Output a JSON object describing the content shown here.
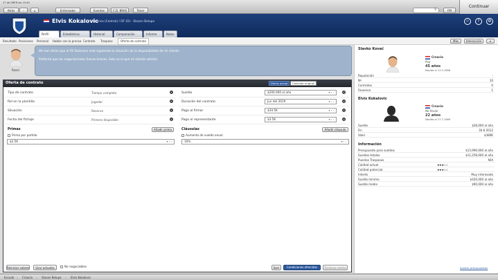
{
  "topbar": {
    "datetime": "17 de ENER las 15:45",
    "back": "Atrás",
    "fwd": "›",
    "nav": [
      "Entrenador",
      "Eventos",
      "C.D. BRAS",
      "Tener"
    ],
    "search_placeholder": "",
    "fm_badge": "FM",
    "continue": "Continuar"
  },
  "player": {
    "name": "Elvis Kokalovic",
    "position": "Defensa (Central) / DF (D) - Slaven Belupo"
  },
  "tabs": [
    "Perfil",
    "Estadísticas",
    "Historial",
    "Comparación",
    "Informe",
    "Notas"
  ],
  "subtabs": [
    "Resultado",
    "Posiciones",
    "Personal",
    "Hablar con la prensa",
    "Contrato",
    "Traspaso",
    "Oferta de contrato"
  ],
  "top_right_dropdowns": [
    "Más",
    "Interacción"
  ],
  "agent": {
    "name": "Rosel",
    "line1": "Me han dicho que el FK Dukovice está siguiendo la situación de la disponibilidad de mi cliente.",
    "line2": "Preferirá que las negociaciones fueran breves. Esto es lo que mi cliente solicita:"
  },
  "offer": {
    "title": "Oferta de contrato",
    "btn_current": "Oferta actual",
    "btn_original": "Contrato original",
    "left_rows": [
      {
        "label": "Tipo de contrato",
        "value": "Tiempo completo"
      },
      {
        "label": "Rol en la plantilla",
        "value": "Jugador"
      },
      {
        "label": "Situación",
        "value": "Reserva"
      },
      {
        "label": "Fecha del fichaje",
        "value": "Primero disponible"
      }
    ],
    "right_rows": [
      {
        "label": "Sueldo",
        "value": "$200.000 al año"
      },
      {
        "label": "Duración del contrato",
        "value": "Jun del 2019"
      },
      {
        "label": "Pago al firmar",
        "value": "$34.5K"
      },
      {
        "label": "Pago al representante",
        "value": "$3.5K"
      }
    ],
    "primas_title": "Primas",
    "primas_add": "Añadir prima",
    "prima_check": "Prima por partido",
    "prima_value": "$2.5K",
    "clausulas_title": "Cláusulas",
    "clausulas_add": "Añadir cláusula",
    "clausula_check": "Aumento de sueldo anual",
    "clausula_value": "10%",
    "btn_reset": "Reiniciar valores",
    "btn_use_current": "Usar actuales",
    "nonnegotiable": "No negociables",
    "btn_exit": "Salir",
    "btn_propose": "Condiciones ofrecidas",
    "btn_done": "Terminar oferta"
  },
  "side": {
    "agent_title": "Slavko Kovač",
    "agent_nation": "Croacia",
    "agent_role": "Pop",
    "agent_age": "45 años",
    "agent_born": "Nacido el 11.9.1966",
    "agent_rows": [
      {
        "k": "Reputación",
        "v": "-"
      },
      {
        "k": "Nº",
        "v": "16"
      },
      {
        "k": "Contratos",
        "v": "0"
      },
      {
        "k": "Favorece",
        "v": "1"
      }
    ],
    "player_title": "Elvis Kokalovic",
    "player_nation": "Croacia",
    "player_role": "No titular",
    "player_age": "22 años",
    "player_born": "Nacido el 17.7.1989",
    "player_rows": [
      {
        "k": "Sueldo",
        "v": "$28,000 al año"
      },
      {
        "k": "Fin",
        "v": "30.6.2012"
      },
      {
        "k": "Valor",
        "v": "$380K"
      }
    ],
    "info_title": "Información",
    "info_rows": [
      {
        "k": "Presupuesto para sueldos",
        "v": "$13,990,000 al año",
        "stars": ""
      },
      {
        "k": "Sueldos totales",
        "v": "$11,258,000 al año",
        "stars": ""
      },
      {
        "k": "Puestos Traspasos",
        "v": "N/A",
        "stars": ""
      },
      {
        "k": "Calidad actual",
        "v": "",
        "stars": "★★★☆☆"
      },
      {
        "k": "Calidad potencial",
        "v": "",
        "stars": "★★★☆☆"
      },
      {
        "k": "Interés",
        "v": "Muy interesado",
        "stars": ""
      },
      {
        "k": "Sueldo mínimo",
        "v": "$420,000 al año",
        "stars": ""
      },
      {
        "k": "Sueldo medio",
        "v": "$90,000 al año",
        "stars": ""
      }
    ],
    "compare_link": "Ajustar presupuestos"
  },
  "breadcrumb": [
    "Escudo",
    "Croacia",
    "Slaven Belupo",
    "Elvis Kokalovic"
  ]
}
